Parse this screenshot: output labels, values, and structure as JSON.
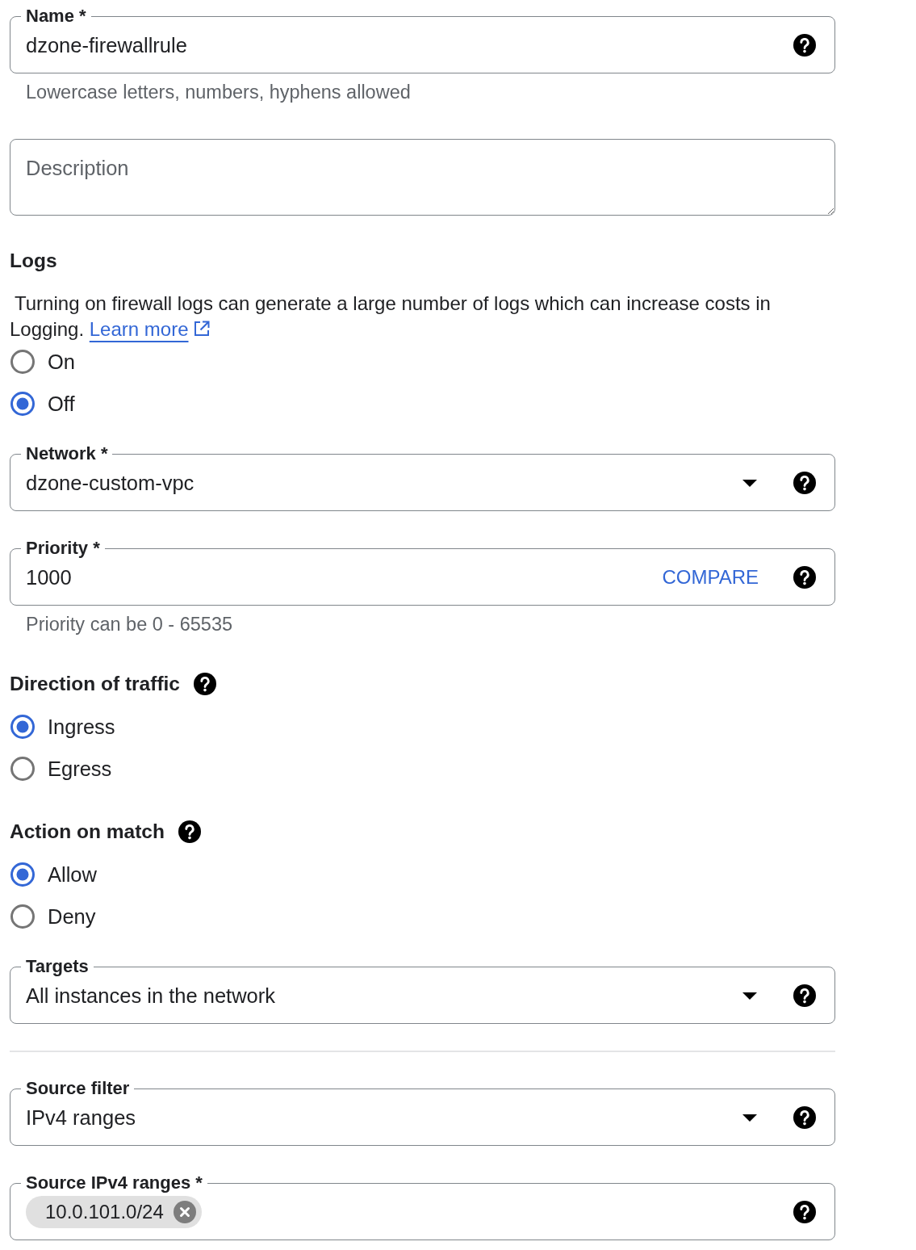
{
  "form": [
    {
      "kind": "text_field",
      "label": "Name *",
      "value": "dzone-firewallrule",
      "helper": "Lowercase letters, numbers, hyphens allowed",
      "help": true
    },
    {
      "kind": "textarea",
      "placeholder": "Description"
    },
    {
      "kind": "radio_group",
      "heading": "Logs",
      "help": false,
      "note": "Turning on firewall logs can generate a large number of logs which can increase costs in Logging.",
      "link": "Learn more",
      "options": [
        {
          "label": "On",
          "selected": false
        },
        {
          "label": "Off",
          "selected": true
        }
      ]
    },
    {
      "kind": "select",
      "label": "Network *",
      "value": "dzone-custom-vpc",
      "help": true
    },
    {
      "kind": "text_field",
      "label": "Priority *",
      "value": "1000",
      "action": "COMPARE",
      "helper": "Priority can be 0 - 65535",
      "help": true
    },
    {
      "kind": "radio_group",
      "heading": "Direction of traffic",
      "help": true,
      "options": [
        {
          "label": "Ingress",
          "selected": true
        },
        {
          "label": "Egress",
          "selected": false
        }
      ]
    },
    {
      "kind": "radio_group",
      "heading": "Action on match",
      "help": true,
      "options": [
        {
          "label": "Allow",
          "selected": true
        },
        {
          "label": "Deny",
          "selected": false
        }
      ]
    },
    {
      "kind": "select",
      "label": "Targets",
      "value": "All instances in the network",
      "help": true
    },
    {
      "kind": "divider"
    },
    {
      "kind": "select",
      "label": "Source filter",
      "value": "IPv4 ranges",
      "help": true
    },
    {
      "kind": "chips_field",
      "label": "Source IPv4 ranges *",
      "chips": [
        "10.0.101.0/24"
      ],
      "help": true
    }
  ]
}
